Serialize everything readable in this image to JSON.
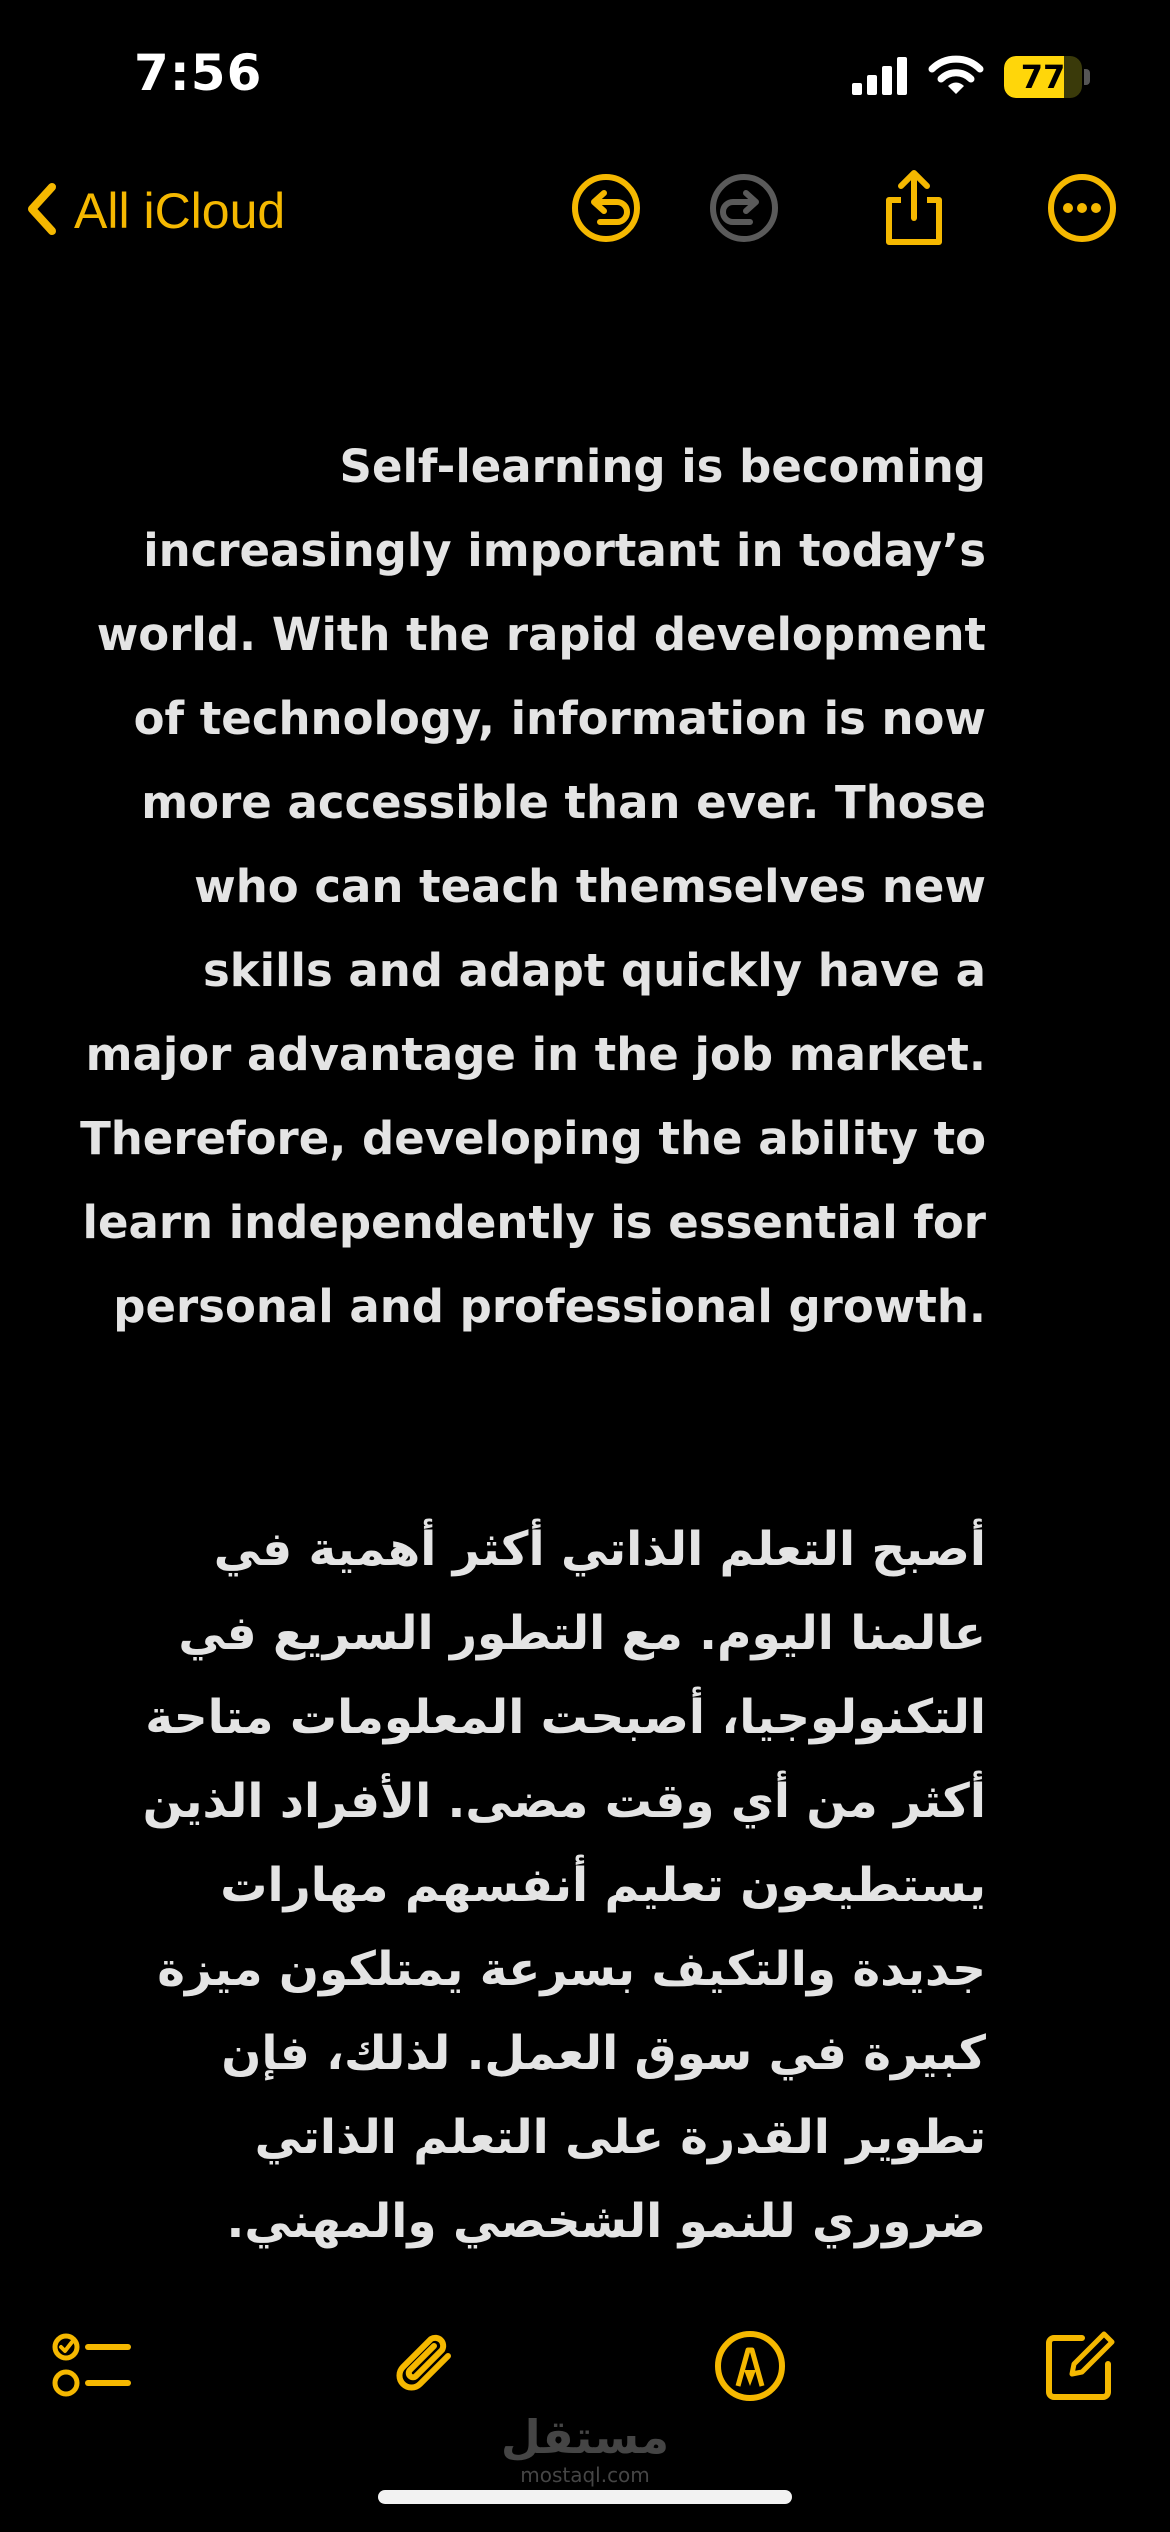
{
  "status_bar": {
    "time": "7:56",
    "battery": "77",
    "battery_level": 0.77
  },
  "nav": {
    "back_label": "All iCloud",
    "accent_color": "#f5b800",
    "disabled_color": "#5a5a5a"
  },
  "note": {
    "english": "Self-learning is becoming increasingly important in today’s world. With the rapid development of technology, information is now more accessible than ever. Those who can teach themselves new skills and adapt quickly have a major advantage in the job market. Therefore, developing the ability to learn independently is essential for personal and professional growth.",
    "arabic": "أصبح التعلم الذاتي أكثر أهمية في عالمنا اليوم. مع التطور السريع في التكنولوجيا، أصبحت المعلومات متاحة أكثر من أي وقت مضى. الأفراد الذين يستطيعون تعليم أنفسهم مهارات جديدة والتكيف بسرعة يمتلكون ميزة كبيرة في سوق العمل. لذلك، فإن تطوير القدرة على التعلم الذاتي ضروري للنمو الشخصي والمهني."
  },
  "watermark": {
    "arabic": "مستقل",
    "latin": "mostaql.com"
  },
  "icons": {
    "back": "chevron-left-icon",
    "undo": "undo-icon",
    "redo": "redo-icon",
    "share": "share-icon",
    "more": "ellipsis-icon",
    "checklist": "checklist-icon",
    "attach": "paperclip-icon",
    "markup": "markup-pen-icon",
    "compose": "compose-icon"
  }
}
